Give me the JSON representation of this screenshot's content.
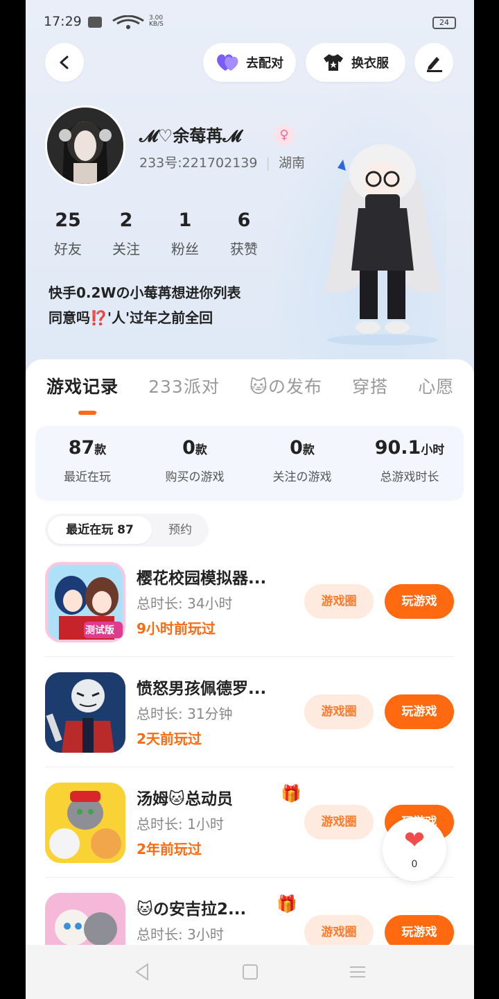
{
  "status_bar": {
    "time": "17:29",
    "net_speed_value": "3.00",
    "net_speed_unit": "KB/S",
    "battery": "24"
  },
  "header": {
    "pair_label": "去配对",
    "dress_label": "换衣服"
  },
  "profile": {
    "nickname": "𝓜♡余莓苒𝓜",
    "uid_text": "233号:221702139",
    "location": "湖南",
    "stats": [
      {
        "value": "25",
        "label": "好友"
      },
      {
        "value": "2",
        "label": "关注"
      },
      {
        "value": "1",
        "label": "粉丝"
      },
      {
        "value": "6",
        "label": "获赞"
      }
    ],
    "bio_line1": "快手0.2Wの小莓苒想进你列表",
    "bio_line2": "同意吗⁉️'人'过年之前全回"
  },
  "tabs": [
    "游戏记录",
    "233派对",
    "🐱の发布",
    "穿搭",
    "心愿"
  ],
  "summary": [
    {
      "value": "87",
      "unit": "款",
      "label": "最近在玩"
    },
    {
      "value": "0",
      "unit": "款",
      "label": "购买の游戏"
    },
    {
      "value": "0",
      "unit": "款",
      "label": "关注の游戏"
    },
    {
      "value": "90.1",
      "unit": "小时",
      "label": "总游戏时长"
    }
  ],
  "filter": {
    "recent_label": "最近在玩 87",
    "reserve_label": "预约"
  },
  "games": [
    {
      "name": "樱花校园模拟器...",
      "duration": "总时长: 34小时",
      "last_played": "9小时前玩过",
      "circle_label": "游戏圈",
      "play_label": "玩游戏",
      "badge": "测试版"
    },
    {
      "name": "愤怒男孩佩德罗...",
      "duration": "总时长: 31分钟",
      "last_played": "2天前玩过",
      "circle_label": "游戏圈",
      "play_label": "玩游戏"
    },
    {
      "name": "汤姆🐱总动员",
      "duration": "总时长: 1小时",
      "last_played": "2年前玩过",
      "circle_label": "游戏圈",
      "play_label": "玩游戏"
    },
    {
      "name": "🐱の安吉拉2...",
      "duration": "总时长: 3小时",
      "last_played": "",
      "circle_label": "游戏圈",
      "play_label": "玩游戏"
    }
  ],
  "like": {
    "count": "0"
  },
  "colors": {
    "accent": "#ff6a10",
    "accent_light": "#feeadf",
    "summary_bg": "#f3f6fd"
  }
}
